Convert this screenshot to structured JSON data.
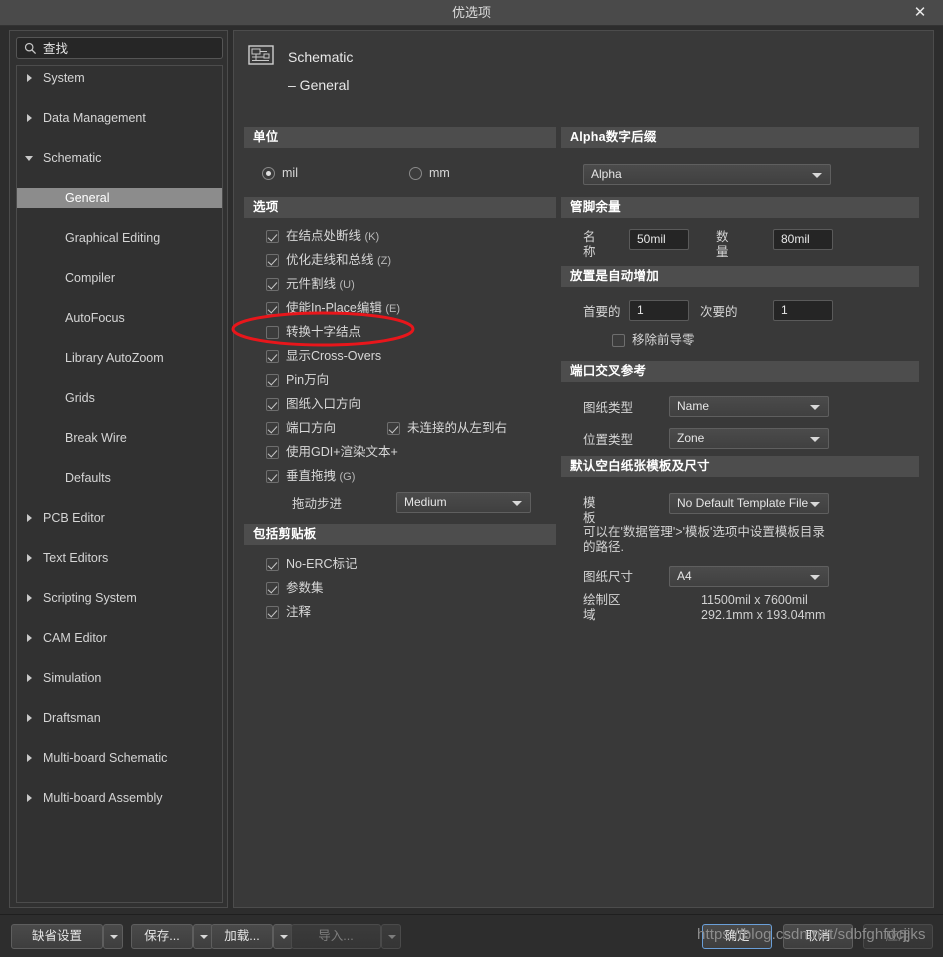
{
  "window": {
    "title": "优选项",
    "close_label": "✕"
  },
  "search": {
    "value": "查找",
    "icon": "search-icon"
  },
  "tree": {
    "items": [
      {
        "label": "System",
        "level": 0,
        "state": "collapsed",
        "selected": false
      },
      {
        "label": "Data Management",
        "level": 0,
        "state": "collapsed",
        "selected": false
      },
      {
        "label": "Schematic",
        "level": 0,
        "state": "expanded",
        "selected": false
      },
      {
        "label": "General",
        "level": 1,
        "state": "leaf",
        "selected": true
      },
      {
        "label": "Graphical Editing",
        "level": 1,
        "state": "leaf",
        "selected": false
      },
      {
        "label": "Compiler",
        "level": 1,
        "state": "leaf",
        "selected": false
      },
      {
        "label": "AutoFocus",
        "level": 1,
        "state": "leaf",
        "selected": false
      },
      {
        "label": "Library AutoZoom",
        "level": 1,
        "state": "leaf",
        "selected": false
      },
      {
        "label": "Grids",
        "level": 1,
        "state": "leaf",
        "selected": false
      },
      {
        "label": "Break Wire",
        "level": 1,
        "state": "leaf",
        "selected": false
      },
      {
        "label": "Defaults",
        "level": 1,
        "state": "leaf",
        "selected": false
      },
      {
        "label": "PCB Editor",
        "level": 0,
        "state": "collapsed",
        "selected": false
      },
      {
        "label": "Text Editors",
        "level": 0,
        "state": "collapsed",
        "selected": false
      },
      {
        "label": "Scripting System",
        "level": 0,
        "state": "collapsed",
        "selected": false
      },
      {
        "label": "CAM Editor",
        "level": 0,
        "state": "collapsed",
        "selected": false
      },
      {
        "label": "Simulation",
        "level": 0,
        "state": "collapsed",
        "selected": false
      },
      {
        "label": "Draftsman",
        "level": 0,
        "state": "collapsed",
        "selected": false
      },
      {
        "label": "Multi-board Schematic",
        "level": 0,
        "state": "collapsed",
        "selected": false
      },
      {
        "label": "Multi-board Assembly",
        "level": 0,
        "state": "collapsed",
        "selected": false
      }
    ]
  },
  "page": {
    "title": "Schematic – General",
    "icon": "schematic-icon"
  },
  "units": {
    "header": "单位",
    "options": [
      {
        "label": "mil",
        "selected": true
      },
      {
        "label": "mm",
        "selected": false
      }
    ]
  },
  "options": {
    "header": "选项",
    "items": [
      {
        "label": "在结点处断线",
        "accel": "(K)",
        "checked": true
      },
      {
        "label": "优化走线和总线",
        "accel": "(Z)",
        "checked": true
      },
      {
        "label": "元件割线",
        "accel": "(U)",
        "checked": true
      },
      {
        "label": "使能In-Place编辑",
        "accel": "(E)",
        "checked": true
      },
      {
        "label": "转换十字结点",
        "accel": "",
        "checked": false
      },
      {
        "label": "显示Cross-Overs",
        "accel": "",
        "checked": true
      },
      {
        "label": "Pin万向",
        "accel": "",
        "checked": true
      },
      {
        "label": "图纸入口方向",
        "accel": "",
        "checked": true
      },
      {
        "label": "端口方向",
        "accel": "",
        "checked": true
      },
      {
        "label": "使用GDI+渲染文本+",
        "accel": "",
        "checked": true
      },
      {
        "label": "垂直拖拽",
        "accel": "(G)",
        "checked": true
      }
    ],
    "unconnected": {
      "label": "未连接的从左到右",
      "checked": true
    },
    "drag_step": {
      "label": "拖动步进",
      "value": "Medium"
    }
  },
  "clipboard": {
    "header": "包括剪贴板",
    "items": [
      {
        "label": "No-ERC标记",
        "checked": true
      },
      {
        "label": "参数集",
        "checked": true
      },
      {
        "label": "注释",
        "checked": true
      }
    ]
  },
  "alpha": {
    "header": "Alpha数字后缀",
    "value": "Alpha"
  },
  "pin_margin": {
    "header": "管脚余量",
    "name_label": "名\n称",
    "name_value": "50mil",
    "qty_label": "数\n量",
    "qty_value": "80mil"
  },
  "auto_increment": {
    "header": "放置是自动增加",
    "primary_label": "首要的",
    "primary_value": "1",
    "secondary_label": "次要的",
    "secondary_value": "1",
    "remove_leading_zeros": {
      "label": "移除前导零",
      "checked": false
    }
  },
  "port_xref": {
    "header": "端口交叉参考",
    "sheet_type_label": "图纸类型",
    "sheet_type_value": "Name",
    "location_type_label": "位置类型",
    "location_type_value": "Zone"
  },
  "default_template": {
    "header": "默认空白纸张模板及尺寸",
    "template_label": "模\n板",
    "template_value": "No Default Template File",
    "hint": "可以在'数据管理'>'模板'选项中设置模板目录的路径.",
    "sheet_size_label": "图纸尺寸",
    "sheet_size_value": "A4",
    "draw_area_label": "绘制区\n域",
    "draw_area_imperial": "11500mil x 7600mil",
    "draw_area_metric": "292.1mm x 193.04mm"
  },
  "footer": {
    "default_settings": "缺省设置",
    "save": "保存...",
    "load": "加载...",
    "import": "导入...",
    "ok": "确定",
    "cancel": "取消",
    "apply": "应用"
  },
  "watermark": "https://blog.csdn.net/sdbfghfdcjjks",
  "colors": {
    "dialog_bg": "#2d2d2d",
    "panel_bg": "#393939",
    "section_header_bg": "#4d4d4d",
    "tree_selected_bg": "#8c8c8c",
    "annotation_red": "#e8161b",
    "primary_border": "#6a9fd8"
  }
}
